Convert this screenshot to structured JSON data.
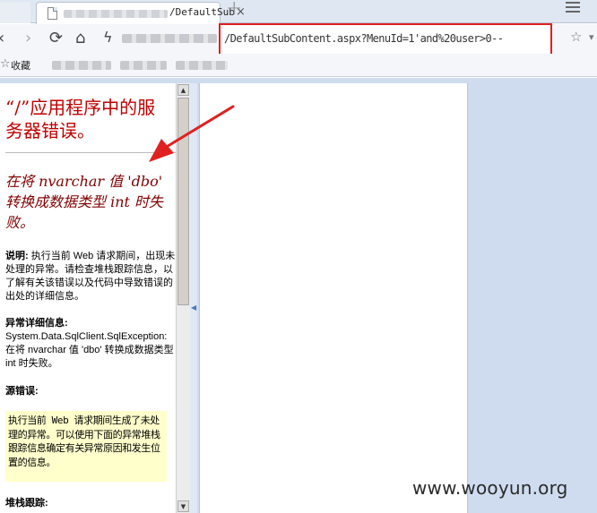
{
  "tab": {
    "title": "/DefaultSubC",
    "close_glyph": "×",
    "new_tab_glyph": "+"
  },
  "address_bar": {
    "url_visible": "/DefaultSubContent.aspx?MenuId=1'and%20user>0--"
  },
  "nav": {
    "back": "‹",
    "forward": "›",
    "refresh": "⟳",
    "home": "⌂",
    "speed": "ϟ",
    "star": "☆",
    "chevron": "▾"
  },
  "bookmarks": {
    "favorites_icon": "☆",
    "favorites_label": "收藏"
  },
  "error_page": {
    "title": "“/”应用程序中的服务器错误。",
    "heading": "在将 nvarchar 值 'dbo' 转换成数据类型 int 时失败。",
    "description_label": "说明:",
    "description_text": "执行当前 Web 请求期间，出现未处理的异常。请检查堆栈跟踪信息，以了解有关该错误以及代码中导致错误的出处的详细信息。",
    "exception_label": "异常详细信息:",
    "exception_type": "System.Data.SqlClient.SqlException:",
    "exception_text": "在将 nvarchar 值 'dbo' 转换成数据类型 int 时失败。",
    "source_label": "源错误:",
    "source_text": "执行当前 Web 请求期间生成了未处理的异常。可以使用下面的异常堆栈跟踪信息确定有关异常原因和发生位置的信息。",
    "stack_label": "堆栈跟踪:"
  },
  "scrollbar": {
    "up": "▲",
    "down": "▼",
    "splitter_arrow": "◀"
  },
  "watermark": "www.wooyun.org",
  "colors": {
    "annotation": "#e02020",
    "error_title": "#c00000",
    "error_heading": "#800000",
    "source_box": "#ffffcc"
  }
}
